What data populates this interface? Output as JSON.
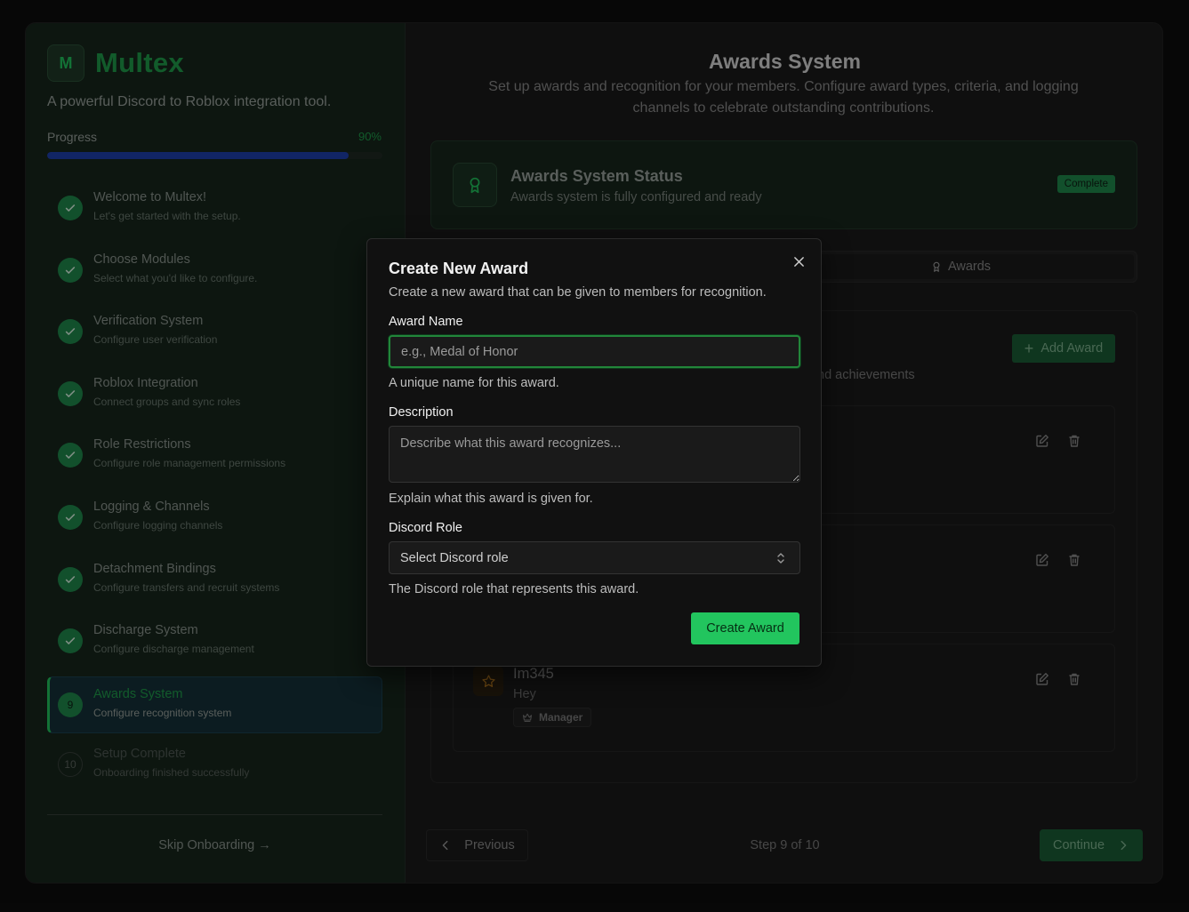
{
  "brand": {
    "logo_letter": "M",
    "name": "Multex",
    "tagline": "A powerful Discord to Roblox integration tool."
  },
  "progress": {
    "label": "Progress",
    "value_text": "90%",
    "fraction": 0.9
  },
  "steps": [
    {
      "title": "Welcome to Multex!",
      "sub": "Let's get started with the setup.",
      "state": "done"
    },
    {
      "title": "Choose Modules",
      "sub": "Select what you'd like to configure.",
      "state": "done"
    },
    {
      "title": "Verification System",
      "sub": "Configure user verification",
      "state": "done"
    },
    {
      "title": "Roblox Integration",
      "sub": "Connect groups and sync roles",
      "state": "done"
    },
    {
      "title": "Role Restrictions",
      "sub": "Configure role management permissions",
      "state": "done"
    },
    {
      "title": "Logging & Channels",
      "sub": "Configure logging channels",
      "state": "done"
    },
    {
      "title": "Detachment Bindings",
      "sub": "Configure transfers and recruit systems",
      "state": "done"
    },
    {
      "title": "Discharge System",
      "sub": "Configure discharge management",
      "state": "done"
    },
    {
      "number": "9",
      "title": "Awards System",
      "sub": "Configure recognition system",
      "state": "active"
    },
    {
      "number": "10",
      "title": "Setup Complete",
      "sub": "Onboarding finished successfully",
      "state": "pending"
    }
  ],
  "skip_label": "Skip Onboarding →",
  "main": {
    "title": "Awards System",
    "subtitle": "Set up awards and recognition for your members. Configure award types, criteria, and logging channels to celebrate outstanding contributions.",
    "status": {
      "title": "Awards System Status",
      "desc": "Awards system is fully configured and ready",
      "badge": "Complete"
    },
    "tab_awards": "Awards",
    "add_award_label": "Add Award",
    "panel_desc_visible": "nd achievements",
    "awards": [
      {
        "name": "",
        "desc": "",
        "role": ""
      },
      {
        "name": "",
        "desc": "",
        "role": ""
      },
      {
        "name": "Im345",
        "desc": "Hey",
        "role": "Manager"
      }
    ],
    "prev_label": "Previous",
    "step_text": "Step 9 of 10",
    "next_label": "Continue"
  },
  "modal": {
    "title": "Create New Award",
    "subtitle": "Create a new award that can be given to members for recognition.",
    "name_label": "Award Name",
    "name_placeholder": "e.g., Medal of Honor",
    "name_value": "",
    "name_hint": "A unique name for this award.",
    "desc_label": "Description",
    "desc_placeholder": "Describe what this award recognizes...",
    "desc_hint": "Explain what this award is given for.",
    "role_label": "Discord Role",
    "role_selected": "Select Discord role",
    "role_hint": "The Discord role that represents this award.",
    "submit_label": "Create Award"
  },
  "colors": {
    "accent": "#22c55e",
    "progress_fill": "#1e40af",
    "modal_bg": "#111111"
  }
}
